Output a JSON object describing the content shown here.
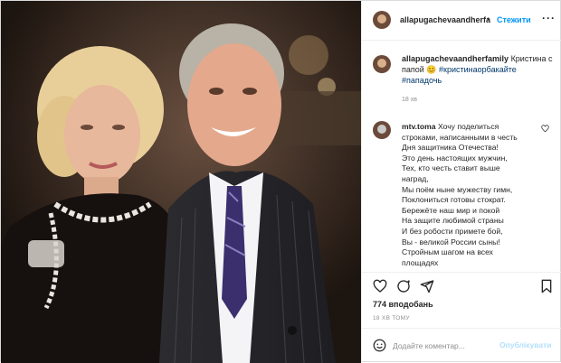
{
  "post": {
    "author": "allapugachevaandherfa",
    "follow_label": "Стежити",
    "more_icon": "more-dots-icon"
  },
  "caption": {
    "author": "allapugachevaandherfamily",
    "text": "Кристина с папой",
    "emoji": "😊",
    "hashtag1": "#кристинаорбакайте",
    "hashtag2": "#пападочь",
    "time": "18 хв"
  },
  "comment": {
    "author": "mtv.toma",
    "lines": [
      "Хочу поделиться",
      "строками, написанными в честь",
      "Дня защитника Отечества!",
      "Это день настоящих мужчин,",
      "Тех, кто честь ставит выше",
      "наград,",
      "Мы поём ныне мужеству гимн,",
      "Поклониться готовы стократ.",
      "Бережёте наш мир и покой",
      "На защите любимой страны",
      "И без робости примете бой,",
      "Вы - великой России сыны!",
      "Стройным шагом на всех",
      "площадях"
    ]
  },
  "actions": {
    "likes": "774 вподобань",
    "age": "18 ХВ ТОМУ"
  },
  "input": {
    "placeholder": "Додайте коментар...",
    "publish_label": "Опублікувати"
  },
  "colors": {
    "accent": "#0095f6",
    "hashtag": "#00376b",
    "muted": "#8e8e8e",
    "publish_disabled": "#b2dffc"
  }
}
